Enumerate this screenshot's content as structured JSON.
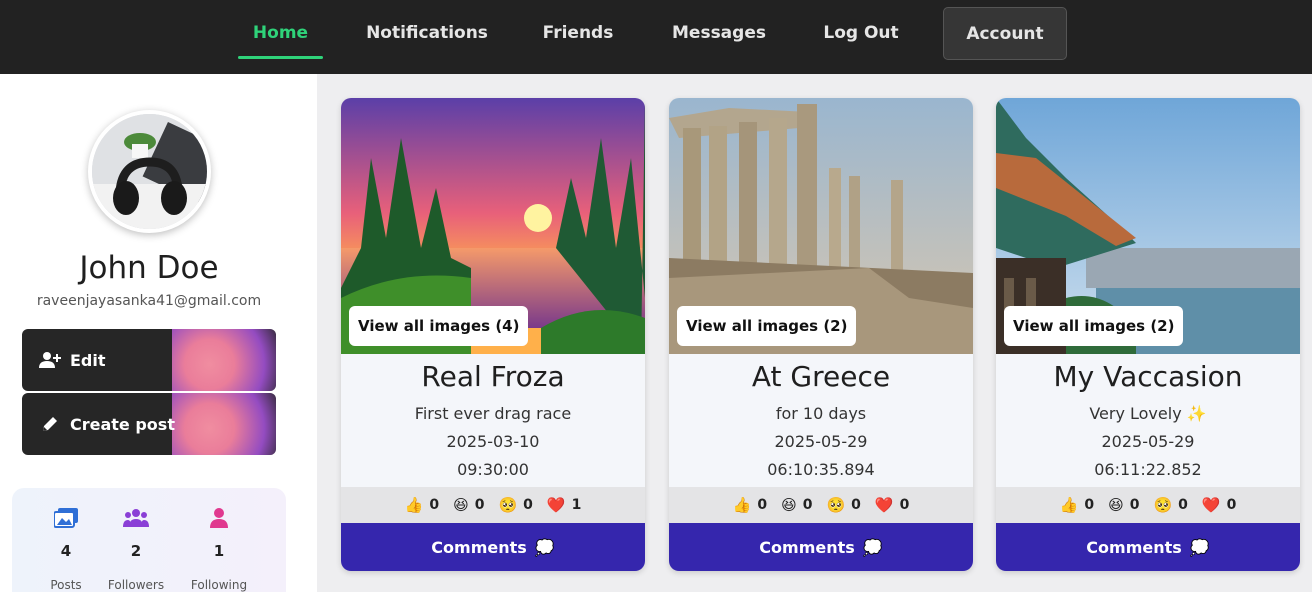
{
  "nav": {
    "items": [
      {
        "label": "Home"
      },
      {
        "label": "Notifications"
      },
      {
        "label": "Friends"
      },
      {
        "label": "Messages"
      },
      {
        "label": "Log Out"
      }
    ],
    "account_label": "Account",
    "accent_color": "#2fd37a"
  },
  "profile": {
    "name": "John Doe",
    "email": "raveenjayasanka41@gmail.com",
    "edit_label": "Edit",
    "create_post_label": "Create post",
    "stats": [
      {
        "value": "4",
        "label": "Posts",
        "icon": "images-icon"
      },
      {
        "value": "2",
        "label": "Followers",
        "icon": "users-group-icon"
      },
      {
        "value": "1",
        "label": "Following",
        "icon": "user-icon"
      }
    ]
  },
  "posts": [
    {
      "view_all": "View all images (4)",
      "title": "Real Froza",
      "description": "First ever drag race",
      "date": "2025-03-10",
      "time": "09:30:00",
      "reactions": [
        {
          "emoji": "👍",
          "count": "0"
        },
        {
          "emoji": "😆",
          "count": "0"
        },
        {
          "emoji": "🥺",
          "count": "0"
        },
        {
          "emoji": "❤️",
          "count": "1"
        }
      ],
      "comments_label": "Comments",
      "comments_icon": "💭"
    },
    {
      "view_all": "View all images (2)",
      "title": "At Greece",
      "description": "for 10 days",
      "date": "2025-05-29",
      "time": "06:10:35.894",
      "reactions": [
        {
          "emoji": "👍",
          "count": "0"
        },
        {
          "emoji": "😆",
          "count": "0"
        },
        {
          "emoji": "🥺",
          "count": "0"
        },
        {
          "emoji": "❤️",
          "count": "0"
        }
      ],
      "comments_label": "Comments",
      "comments_icon": "💭"
    },
    {
      "view_all": "View all images (2)",
      "title": "My Vaccasion",
      "description": "Very Lovely ✨",
      "date": "2025-05-29",
      "time": "06:11:22.852",
      "reactions": [
        {
          "emoji": "👍",
          "count": "0"
        },
        {
          "emoji": "😆",
          "count": "0"
        },
        {
          "emoji": "🥺",
          "count": "0"
        },
        {
          "emoji": "❤️",
          "count": "0"
        }
      ],
      "comments_label": "Comments",
      "comments_icon": "💭"
    }
  ],
  "colors": {
    "nav_bg": "#222222",
    "comments_button": "#3526ad",
    "stat_icon_blue": "#2f6fd6",
    "stat_icon_purple": "#8a3fd6",
    "stat_icon_pink": "#e0398f"
  }
}
